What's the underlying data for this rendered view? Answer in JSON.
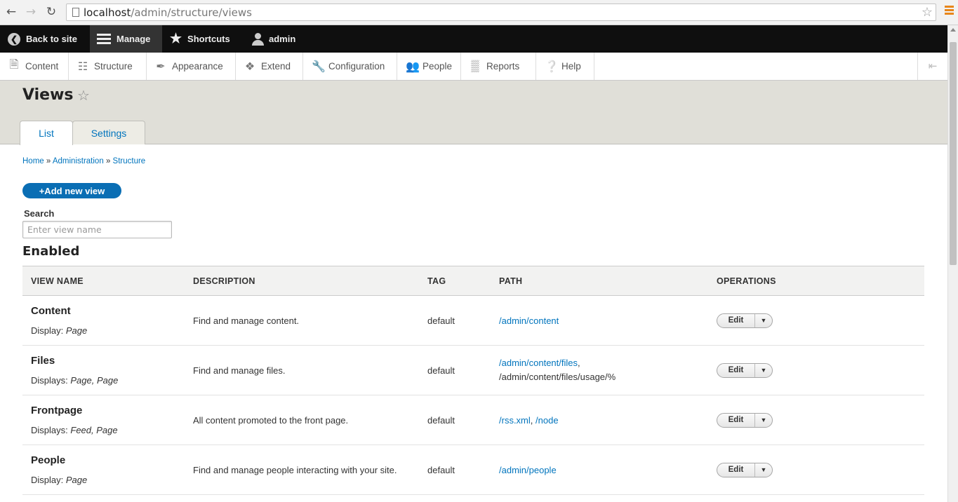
{
  "browser": {
    "url_host": "localhost",
    "url_path": "/admin/structure/views"
  },
  "toolbar": {
    "back_to_site": "Back to site",
    "manage": "Manage",
    "shortcuts": "Shortcuts",
    "user": "admin"
  },
  "tray": {
    "items": [
      "Content",
      "Structure",
      "Appearance",
      "Extend",
      "Configuration",
      "People",
      "Reports",
      "Help"
    ]
  },
  "page": {
    "title": "Views",
    "tabs": [
      "List",
      "Settings"
    ]
  },
  "breadcrumb": {
    "items": [
      "Home",
      "Administration",
      "Structure"
    ],
    "separator": "»"
  },
  "actions": {
    "add_new_view": "+Add new view"
  },
  "search": {
    "label": "Search",
    "placeholder": "Enter view name"
  },
  "enabled": {
    "title": "Enabled",
    "columns": [
      "VIEW NAME",
      "DESCRIPTION",
      "TAG",
      "PATH",
      "OPERATIONS"
    ],
    "rows": [
      {
        "name": "Content",
        "display_label": "Display:",
        "display_value": "Page",
        "description": "Find and manage content.",
        "tag": "default",
        "path_links": [
          "/admin/content"
        ],
        "path_plain": "",
        "op": "Edit"
      },
      {
        "name": "Files",
        "display_label": "Displays:",
        "display_value": "Page, Page",
        "description": "Find and manage files.",
        "tag": "default",
        "path_links": [
          "/admin/content/files"
        ],
        "path_plain": "/admin/content/files/usage/%",
        "op": "Edit"
      },
      {
        "name": "Frontpage",
        "display_label": "Displays:",
        "display_value": "Feed, Page",
        "description": "All content promoted to the front page.",
        "tag": "default",
        "path_links": [
          "/rss.xml",
          "/node"
        ],
        "path_plain": "",
        "op": "Edit"
      },
      {
        "name": "People",
        "display_label": "Display:",
        "display_value": "Page",
        "description": "Find and manage people interacting with your site.",
        "tag": "default",
        "path_links": [
          "/admin/people"
        ],
        "path_plain": "",
        "op": "Edit"
      }
    ]
  },
  "colors": {
    "link": "#0074bd",
    "primary_button": "#0a6eb4",
    "toolbar_bg": "#0f0f0f",
    "header_bg": "#e0dfd8"
  }
}
